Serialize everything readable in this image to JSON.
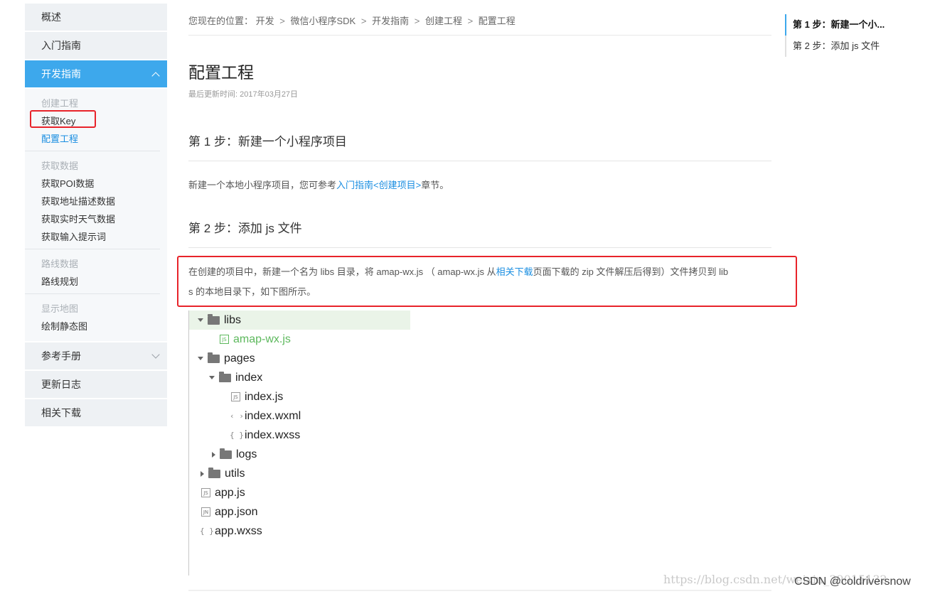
{
  "sidebar": {
    "overview": "概述",
    "getting_started": "入门指南",
    "dev_guide": "开发指南",
    "groups": [
      {
        "title": "创建工程",
        "items": [
          "获取Key",
          "配置工程"
        ]
      },
      {
        "title": "获取数据",
        "items": [
          "获取POI数据",
          "获取地址描述数据",
          "获取实时天气数据",
          "获取输入提示词"
        ]
      },
      {
        "title": "路线数据",
        "items": [
          "路线规划"
        ]
      },
      {
        "title": "显示地图",
        "items": [
          "绘制静态图"
        ]
      }
    ],
    "reference": "参考手册",
    "changelog": "更新日志",
    "downloads": "相关下载"
  },
  "breadcrumb": {
    "prefix": "您现在的位置：",
    "items": [
      "开发",
      "微信小程序SDK",
      "开发指南",
      "创建工程",
      "配置工程"
    ],
    "sep": ">"
  },
  "page": {
    "title": "配置工程",
    "updated": "最后更新时间: 2017年03月27日"
  },
  "step1": {
    "title": "第 1 步：新建一个小程序项目",
    "text_before": "新建一个本地小程序项目，您可参考",
    "link": "入门指南<创建项目>",
    "text_after": "章节。"
  },
  "step2": {
    "title": "第 2 步：添加 js 文件",
    "line1_before": "在创建的项目中，新建一个名为 libs 目录，将 amap-wx.js （ amap-wx.js  从",
    "line1_link": "相关下载",
    "line1_after": "页面下载的 zip 文件解压后得到）文件拷贝到 lib",
    "line2": "s 的本地目录下，如下图所示。"
  },
  "tree": {
    "libs": "libs",
    "amap": "amap-wx.js",
    "pages": "pages",
    "index": "index",
    "index_js": "index.js",
    "index_wxml": "index.wxml",
    "index_wxss": "index.wxss",
    "logs": "logs",
    "utils": "utils",
    "app_js": "app.js",
    "app_json": "app.json",
    "app_wxss": "app.wxss",
    "badge_js": "JS",
    "badge_json": "JN",
    "glyph_xml": "‹ ›",
    "glyph_css": "{ }"
  },
  "toc": [
    "第 1 步：新建一个小...",
    "第 2 步：添加 js 文件"
  ],
  "watermark": {
    "url": "https://blog.csdn.net/weixin_39015132",
    "credit": "CSDN @coldriversnow"
  },
  "colors": {
    "accent": "#3da8ec",
    "link": "#1a8ee1",
    "highlight_box": "#e8232a",
    "tree_highlight": "#eaf4e8",
    "file_green": "#5cb85c"
  }
}
